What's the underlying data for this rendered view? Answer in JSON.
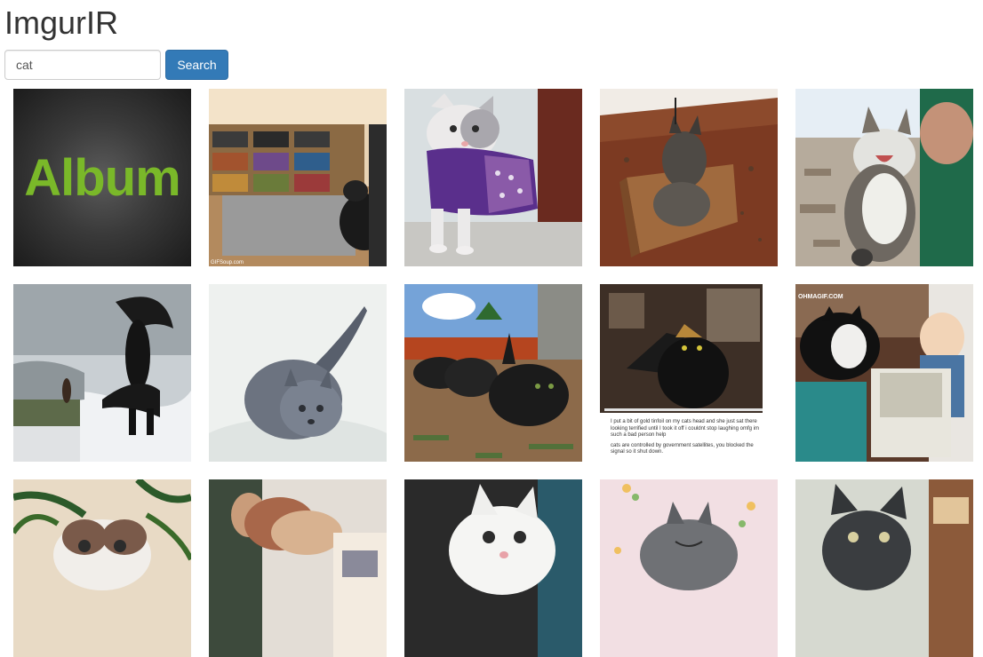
{
  "app": {
    "title": "ImgurIR"
  },
  "search": {
    "value": "cat",
    "button_label": "Search"
  },
  "results": {
    "album_label": "Album",
    "gifsoup_credit": "GIFSoup.com",
    "ohmagif_watermark": "OHMAGIF.COM",
    "tumblr_caption": [
      "I put a bit of gold tinfoil on my cats head and she just sat there looking terrified until I took it off i couldnt stop laughing omfg im such a bad person help",
      "cats are controlled by government satellites, you blocked the signal so it shut down."
    ]
  }
}
